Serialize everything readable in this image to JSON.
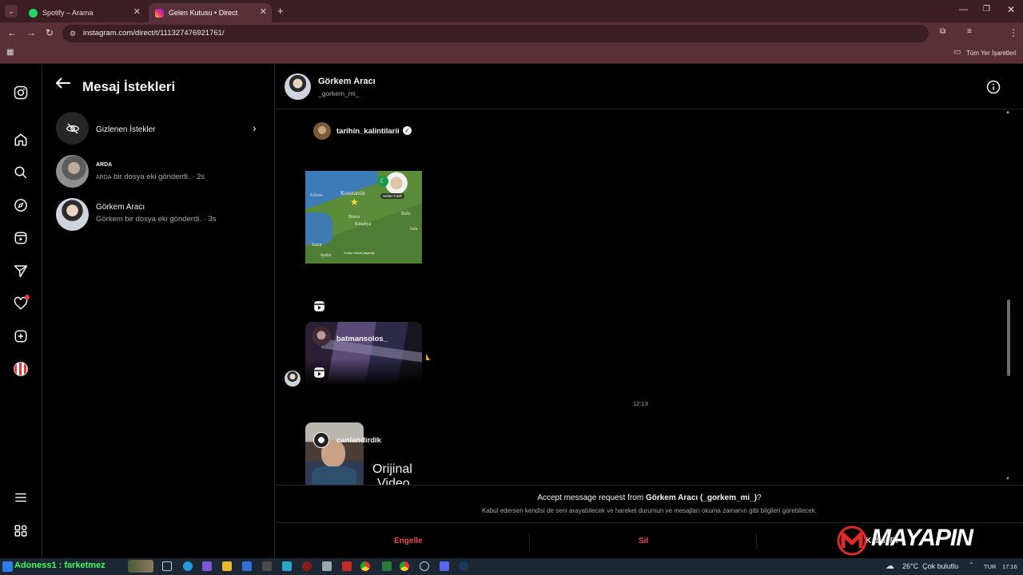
{
  "browser": {
    "tabs": [
      {
        "title": "Spotify – Arama",
        "active": false
      },
      {
        "title": "Gelen Kutusu • Direct",
        "active": true
      }
    ],
    "url": "instagram.com/direct/t/111327476921761/",
    "bookmarks_folder": "Tüm Yer İşaretleri"
  },
  "requests": {
    "title": "Mesaj İstekleri",
    "hidden_label": "Gizlenen İstekler",
    "items": [
      {
        "name": "ARDA",
        "preview_name": "ARDA",
        "preview": "bir dosya eki gönderdi.",
        "time": "· 2s"
      },
      {
        "name": "Görkem Aracı",
        "preview": "Görkem bir dosya eki gönderdi.",
        "time": "· 3s"
      }
    ]
  },
  "chat": {
    "name": "Görkem Aracı",
    "username": "_gorkem_mi_",
    "posts": [
      {
        "account": "tarihin_kalintilarii",
        "verified": true
      },
      {
        "account": "batmansolos_"
      },
      {
        "account": "canlandirdik",
        "overlay": "Orijinal",
        "overlay2": "Video"
      }
    ],
    "map_labels": {
      "edirne": "Edirne",
      "konstantin": "Konstantin",
      "bursa": "Bursa",
      "kutahya": "Kütahya",
      "izmir": "İzmir",
      "aydin": "Aydın",
      "bolu": "Bolu",
      "ank": "Ank",
      "badge": "Sultan Fatih",
      "caption": "Sultan Murat yaşadığı"
    },
    "time_separator": "12:13",
    "accept_prefix": "Accept message request from ",
    "accept_name": "Görkem Aracı (_gorkem_mi_)",
    "accept_suffix": "?",
    "accept_note": "Kabul edersen kendisi de seni arayabilecek ve hareket durumun ve mesajları okuma zamanın gibi bilgileri görebilecek.",
    "actions": {
      "block": "Engelle",
      "delete": "Sil",
      "accept": "Kabul Et"
    }
  },
  "watermark": "MAYAPIN",
  "taskbar": {
    "user_text": "Adoness1 : farketmez",
    "weather": "26°C  Çok bulutlu",
    "lang": "TUR",
    "time": "17:16"
  },
  "colors": {
    "accent_red": "#ed4956",
    "chrome_dark": "#3a1e24",
    "chrome_bar": "#5a3038",
    "watermark_red": "#e02a2a"
  }
}
